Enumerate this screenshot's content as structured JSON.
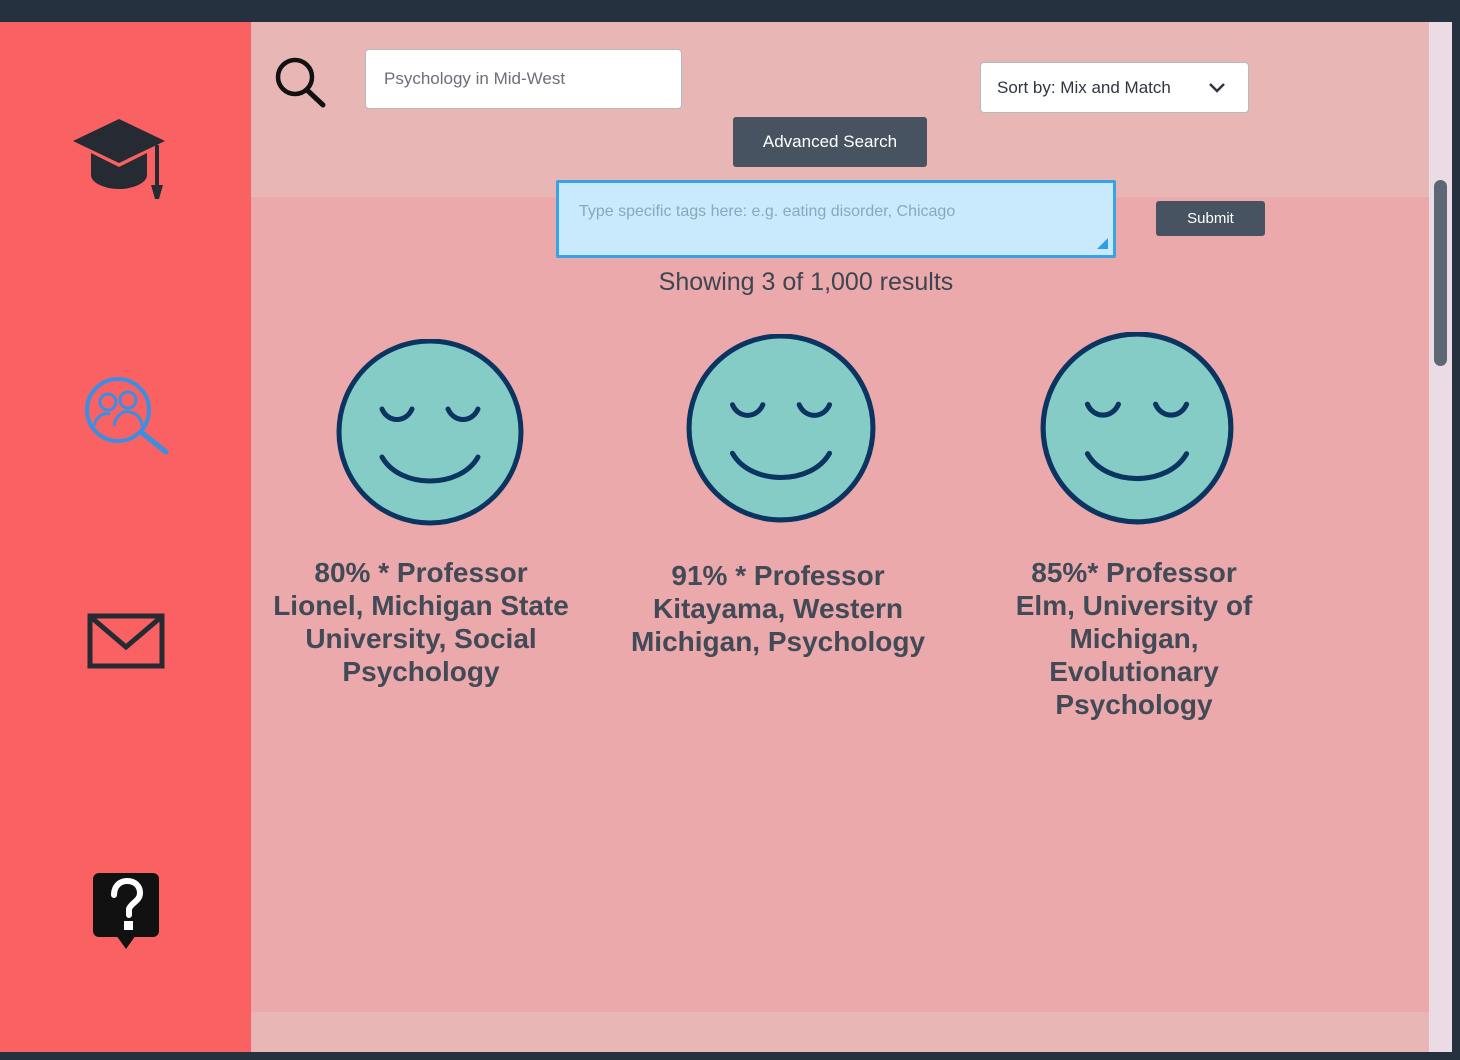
{
  "sidebar": {
    "items": [
      {
        "name": "graduation-cap-icon"
      },
      {
        "name": "people-search-icon",
        "accent": "#3b8fe2"
      },
      {
        "name": "mail-icon"
      },
      {
        "name": "help-question-icon"
      }
    ],
    "background": "#f96163"
  },
  "search": {
    "placeholder": "Psychology in Mid-West",
    "icon": "search-icon"
  },
  "sort": {
    "label": "Sort by: Mix and Match",
    "icon": "chevron-down-icon"
  },
  "advanced_search": {
    "label": "Advanced Search"
  },
  "tags": {
    "placeholder": "Type specific tags here: e.g. eating disorder, Chicago"
  },
  "submit": {
    "label": "Submit"
  },
  "results": {
    "summary": "Showing 3 of 1,000 results",
    "cards": [
      {
        "caption": "80% * Professor Lionel, Michigan State University, Social Psychology",
        "icon": "smiley-face-icon"
      },
      {
        "caption": "91% * Professor Kitayama, Western Michigan, Psychology",
        "icon": "smiley-face-icon"
      },
      {
        "caption": "85%* Professor Elm, University of Michigan, Evolutionary Psychology",
        "icon": "smiley-face-icon"
      }
    ]
  },
  "colors": {
    "main_bg": "#eba9ab",
    "header_bg": "#e9b6b6",
    "button_bg": "#485361",
    "face_fill": "#85cbc6",
    "face_stroke": "#0b3461"
  }
}
